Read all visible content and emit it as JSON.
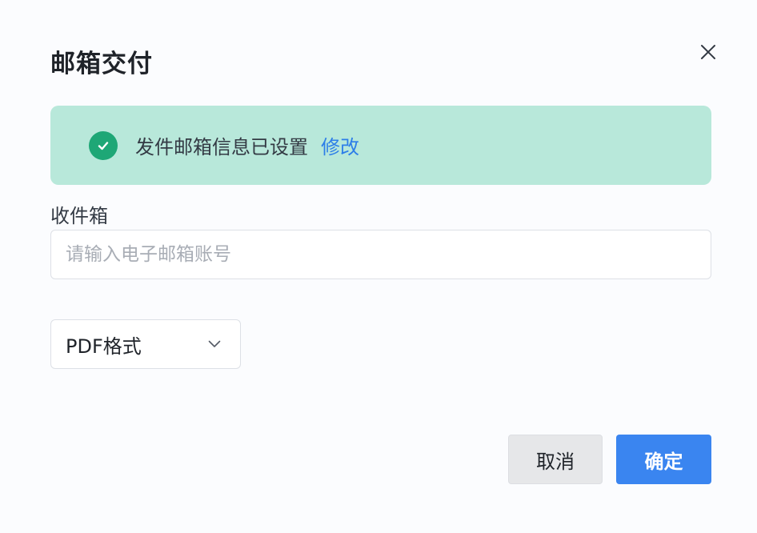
{
  "dialog": {
    "title": "邮箱交付",
    "close_icon": "close-icon"
  },
  "banner": {
    "icon": "check-circle-icon",
    "message": "发件邮箱信息已设置",
    "link_label": "修改",
    "background": "#b8e8da",
    "icon_color": "#1ea776",
    "link_color": "#2d7ee8"
  },
  "recipient": {
    "label": "收件箱",
    "placeholder": "请输入电子邮箱账号",
    "value": ""
  },
  "format": {
    "selected": "PDF格式",
    "icon": "chevron-down-icon"
  },
  "footer": {
    "cancel_label": "取消",
    "confirm_label": "确定",
    "accent": "#3a85f0"
  }
}
